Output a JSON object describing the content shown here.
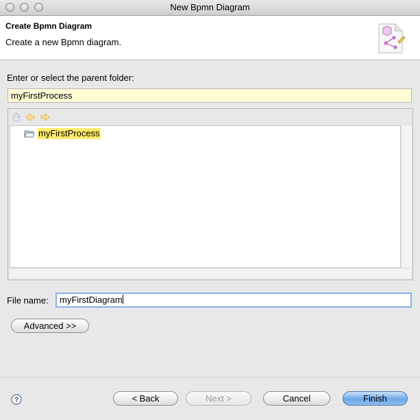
{
  "window": {
    "title": "New Bpmn Diagram"
  },
  "banner": {
    "title": "Create Bpmn Diagram",
    "description": "Create a new Bpmn diagram."
  },
  "parent_folder": {
    "label": "Enter or select the parent folder:",
    "value": "myFirstProcess"
  },
  "tree": {
    "toolbar": [
      "home-icon",
      "back-arrow-icon",
      "forward-arrow-icon"
    ],
    "items": [
      {
        "label": "myFirstProcess",
        "icon": "open-folder-icon",
        "selected": true
      }
    ]
  },
  "file_name": {
    "label": "File name:",
    "value": "myFirstDiagram"
  },
  "buttons": {
    "advanced": "Advanced >>",
    "back": "< Back",
    "next": "Next >",
    "cancel": "Cancel",
    "finish": "Finish"
  },
  "colors": {
    "selection_highlight": "#ffea6a",
    "folder_field_bg": "#fffcd6",
    "primary_button": "#6ea7e8"
  }
}
